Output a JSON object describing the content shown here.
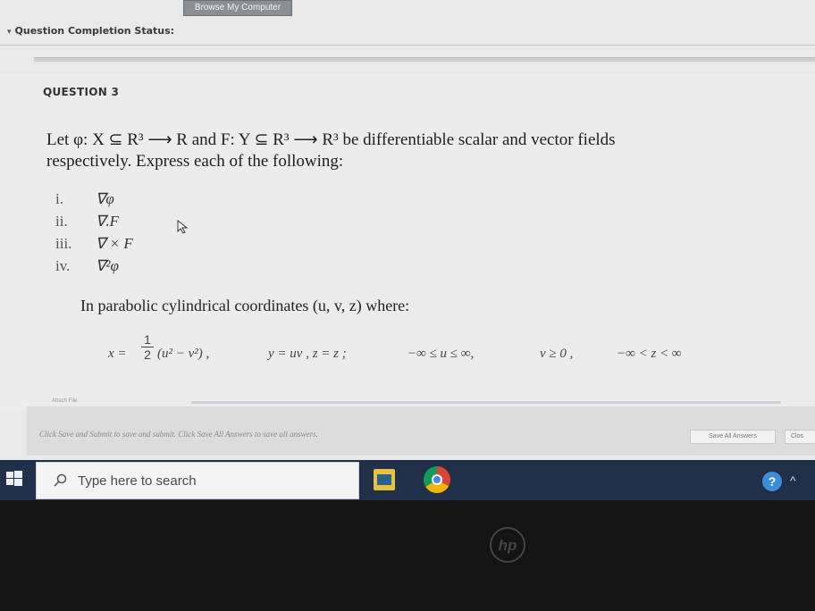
{
  "browser": {
    "browse_button": "Browse My Computer"
  },
  "status": {
    "label": "Question Completion Status:"
  },
  "question": {
    "title": "QUESTION 3",
    "text_line1": "Let φ: X ⊆ R³ ⟶ R and F: Y ⊆ R³ ⟶ R³ be differentiable scalar and vector fields",
    "text_line2": "respectively. Express each of the following:",
    "items": [
      {
        "num": "i.",
        "expr": "∇φ"
      },
      {
        "num": "ii.",
        "expr": "∇.F"
      },
      {
        "num": "iii.",
        "expr": "∇ × F"
      },
      {
        "num": "iv.",
        "expr": "∇²φ"
      }
    ],
    "coords_text": "In parabolic cylindrical coordinates (u, v, z) where:",
    "eq_x_prefix": "x =",
    "eq_frac_num": "1",
    "eq_frac_den": "2",
    "eq_x_rest": "(u² − v²) ,",
    "eq_y": "y = uv ,  z = z  ;",
    "eq_u": "−∞ ≤ u ≤ ∞,",
    "eq_v": "v ≥ 0 ,",
    "eq_z": "−∞ < z < ∞"
  },
  "footer": {
    "attach_label": "Attach File",
    "instructions": "Click Save and Submit to save and submit. Click Save All Answers to save all answers.",
    "save_all": "Save All Answers",
    "close": "Clos"
  },
  "taskbar": {
    "search_placeholder": "Type here to search"
  },
  "bezel": {
    "logo": "hp"
  }
}
